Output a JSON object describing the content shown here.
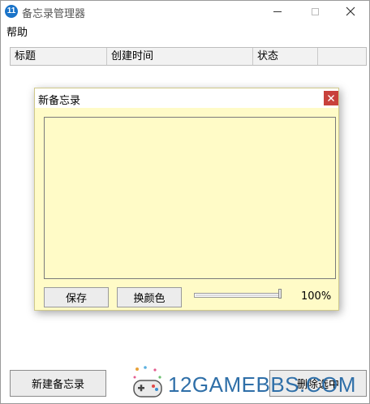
{
  "window": {
    "title": "备忘录管理器",
    "app_icon_glyph": "11",
    "accent": "#1a73c8"
  },
  "menu": {
    "help": "帮助"
  },
  "list": {
    "columns": [
      "标题",
      "创建时间",
      "状态",
      ""
    ]
  },
  "buttons": {
    "new_note": "新建备忘录",
    "delete_selected": "删除选中"
  },
  "dialog": {
    "title": "新备忘录",
    "note_text": "",
    "save": "保存",
    "change_color": "换颜色",
    "opacity_value": 100,
    "opacity_label": "100%",
    "background_color": "#fffbc7",
    "close_color": "#c8413b"
  },
  "watermark": {
    "text": "12GAMEBBS.COM"
  }
}
